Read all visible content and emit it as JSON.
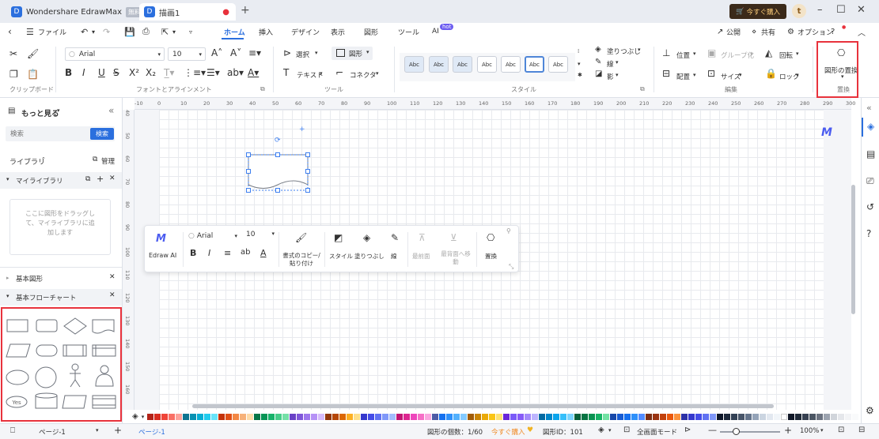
{
  "title_bar": {
    "app_tab": "Wondershare EdrawMax",
    "free_badge": "無料",
    "doc_tab": "描画1",
    "buy_button": "今すぐ購入",
    "avatar_letter": "t"
  },
  "menu": {
    "file": "ファイル",
    "tabs": [
      "ホーム",
      "挿入",
      "デザイン",
      "表示",
      "図形",
      "ツール",
      "AI"
    ],
    "ai_badge": "hot",
    "right": [
      "公開",
      "共有",
      "オプション"
    ]
  },
  "ribbon": {
    "font_name": "Arial",
    "font_size": "10",
    "select": "選択",
    "shape": "図形",
    "text": "テキスト",
    "connector": "コネクタ",
    "style_sample": "Abc",
    "fill": "塗りつぶし",
    "line": "線",
    "shadow": "影",
    "position": "位置",
    "group": "グループ化",
    "rotate": "回転",
    "align": "配置",
    "size": "サイズ",
    "lock": "ロック",
    "replace_shape": "図形の置換",
    "groups": [
      "クリップボード",
      "フォントとアラインメント",
      "ツール",
      "スタイル",
      "編集",
      "置換"
    ]
  },
  "left_panel": {
    "more": "もっと見る",
    "search_placeholder": "検索",
    "search_button": "検索",
    "library": "ライブラリ",
    "manage": "管理",
    "my_library": "マイライブラリ",
    "drop_hint": "ここに図形をドラッグして、マイライブラリに追加します",
    "basic_shapes": "基本図形",
    "basic_flowchart": "基本フローチャート",
    "yes_label": "Yes"
  },
  "rulers": {
    "h": [
      "-10",
      "0",
      "10",
      "20",
      "30",
      "40",
      "50",
      "60",
      "70",
      "80",
      "90",
      "100",
      "110",
      "120",
      "130",
      "140",
      "150",
      "160",
      "170",
      "180",
      "190",
      "200",
      "210",
      "220",
      "230",
      "240",
      "250",
      "260",
      "270",
      "280",
      "290",
      "300"
    ],
    "v": [
      "40",
      "50",
      "60",
      "70",
      "80",
      "90",
      "100",
      "110",
      "120",
      "130",
      "140",
      "150",
      "160"
    ]
  },
  "floating_toolbar": {
    "edraw_ai": "Edraw AI",
    "font": "Arial",
    "size": "10",
    "format_copy": "書式のコピー/貼り付け",
    "style": "スタイル",
    "fill": "塗りつぶし",
    "line": "線",
    "front": "最前面",
    "back": "最背面へ移動",
    "replace": "置換"
  },
  "status": {
    "page_sel": "ページ-1",
    "page_tab": "ページ-1",
    "shape_count": "図形の個数：1/60",
    "buy_now": "今すぐ購入",
    "shape_id": "図形ID：101",
    "fullscreen": "全画面モード",
    "zoom": "100%"
  },
  "palette": [
    "#b42318",
    "#d92d20",
    "#f04438",
    "#f97066",
    "#fda29b",
    "#0e7490",
    "#0891b2",
    "#06aed4",
    "#22ccee",
    "#67e3f9",
    "#c4320a",
    "#e04f16",
    "#f38744",
    "#f7b27a",
    "#fddcab",
    "#067647",
    "#079455",
    "#17b26a",
    "#47cd89",
    "#75e0a7",
    "#6941c6",
    "#7f56d9",
    "#9e77ed",
    "#b692f6",
    "#d6bbfb",
    "#93370d",
    "#b54708",
    "#dc6803",
    "#fdb022",
    "#fedf89",
    "#3538cd",
    "#444ce7",
    "#6172f3",
    "#8098f9",
    "#a4bcfd",
    "#c11574",
    "#dd2590",
    "#ee46bc",
    "#f670c7",
    "#faa7e0",
    "#4e5ba6",
    "#1570ef",
    "#2e90fa",
    "#53b1fd",
    "#84caff",
    "#a15c07",
    "#ca8504",
    "#eaaa08",
    "#fac515",
    "#fde272",
    "#6927da",
    "#7a5af8",
    "#875bf7",
    "#a48afb",
    "#bdb4fe",
    "#026aa2",
    "#0086c9",
    "#0ba5ec",
    "#36bffa",
    "#7cd4fd",
    "#05603a",
    "#087443",
    "#099250",
    "#16b364",
    "#73e2a3",
    "#1849a9",
    "#175cd3",
    "#1570ef",
    "#2e90fa",
    "#528bff",
    "#7c2d12",
    "#9a3412",
    "#c2410c",
    "#ea580c",
    "#fb923c",
    "#2d31a6",
    "#3538cd",
    "#444ce7",
    "#6172f3",
    "#8098f9",
    "#0f172a",
    "#1e293b",
    "#334155",
    "#475569",
    "#64748b",
    "#94a3b8",
    "#cbd5e1",
    "#e2e8f0",
    "#f1f5f9",
    "#ffffff",
    "#111827",
    "#1f2937",
    "#374151",
    "#4b5563",
    "#6b7280",
    "#9ca3af",
    "#d1d5db",
    "#e5e7eb",
    "#f3f4f6",
    "#f9fafb"
  ]
}
